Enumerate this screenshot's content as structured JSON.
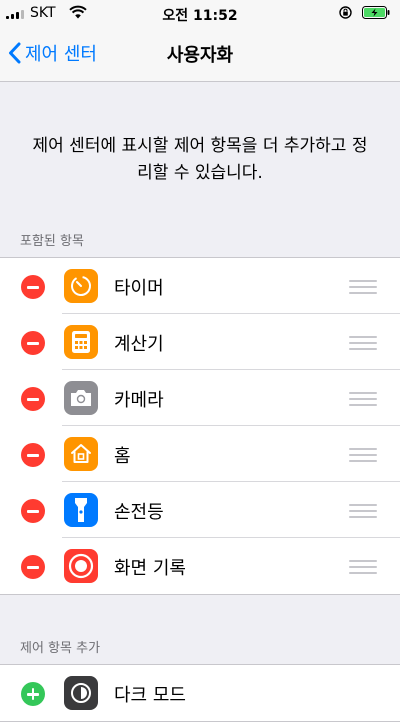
{
  "status_bar": {
    "carrier": "SKT",
    "time": "오전 11:52",
    "battery_color": "#4cd964"
  },
  "nav": {
    "back_label": "제어 센터",
    "title": "사용자화"
  },
  "description": "제어 센터에 표시할 제어 항목을 더 추가하고 정리할 수 있습니다.",
  "included_section": {
    "header": "포함된 항목",
    "items": [
      {
        "label": "타이머",
        "icon": "timer-icon",
        "color": "#ff9500"
      },
      {
        "label": "계산기",
        "icon": "calculator-icon",
        "color": "#ff9500"
      },
      {
        "label": "카메라",
        "icon": "camera-icon",
        "color": "#8e8e93"
      },
      {
        "label": "홈",
        "icon": "home-icon",
        "color": "#ff9500"
      },
      {
        "label": "손전등",
        "icon": "flashlight-icon",
        "color": "#007aff"
      },
      {
        "label": "화면 기록",
        "icon": "screen-recording-icon",
        "color": "#ff3b30"
      }
    ]
  },
  "more_section": {
    "header": "제어 항목 추가",
    "items": [
      {
        "label": "다크 모드",
        "icon": "dark-mode-icon",
        "color": "#3a3a3c"
      }
    ]
  },
  "colors": {
    "accent": "#007aff",
    "remove": "#ff3b30",
    "add": "#34c759"
  }
}
